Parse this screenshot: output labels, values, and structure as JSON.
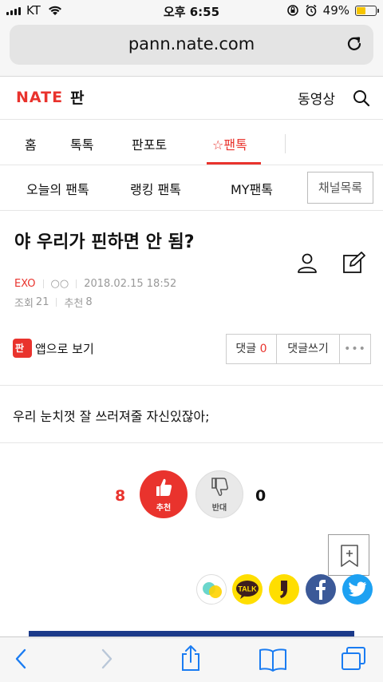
{
  "status_bar": {
    "carrier": "KT",
    "time": "오후 6:55",
    "battery": "49%",
    "battery_level": 0.49
  },
  "browser": {
    "url": "pann.nate.com"
  },
  "header": {
    "logo": "NATE",
    "logo_sub": "판",
    "video_link": "동영상"
  },
  "nav": {
    "items": [
      "홈",
      "톡톡",
      "판포토",
      "☆팬톡"
    ],
    "active_index": 3
  },
  "subnav": {
    "items": [
      "오늘의 팬톡",
      "랭킹 팬톡",
      "MY팬톡"
    ],
    "channel_button": "채널목록"
  },
  "article": {
    "title": "야 우리가 핀하면 안 됨?",
    "category": "EXO",
    "author": "○○",
    "date": "2018.02.15 18:52",
    "views_label": "조회",
    "views": "21",
    "recommend_label": "추천",
    "recommend": "8",
    "app_view": "앱으로 보기",
    "comment_label": "댓글",
    "comment_count": "0",
    "write_comment": "댓글쓰기",
    "more": "•••",
    "content": "우리 눈치껏 잘 쓰러져줄 자신있잖아;"
  },
  "vote": {
    "up_count": "8",
    "up_label": "추천",
    "down_label": "반대",
    "down_count": "0"
  },
  "share": {
    "talk_label": "TALK"
  },
  "colors": {
    "brand_red": "#e9332d",
    "facebook": "#3b5998",
    "twitter": "#1da1f2",
    "kakao": "#ffde00"
  }
}
